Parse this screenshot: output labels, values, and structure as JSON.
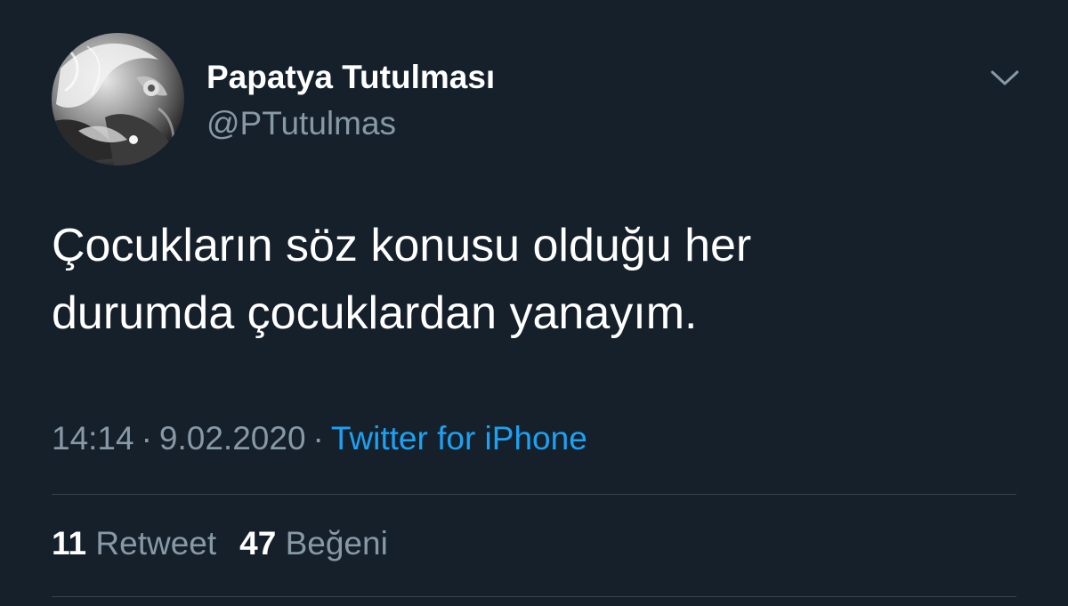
{
  "tweet": {
    "author": {
      "display_name": "Papatya Tutulması",
      "handle": "@PTutulmas"
    },
    "text_lines": [
      "Çocukların söz konusu olduğu her",
      "durumda çocuklardan yanayım."
    ],
    "time": "14:14",
    "separator": "·",
    "date": "9.02.2020",
    "source": "Twitter for iPhone",
    "stats": {
      "retweets_count": "11",
      "retweets_label": "Retweet",
      "likes_count": "47",
      "likes_label": "Beğeni"
    },
    "icons": {
      "menu": "chevron-down-icon"
    }
  },
  "theme": {
    "background": "#15202b",
    "primary_text": "#ffffff",
    "secondary_text": "#8899a6",
    "accent": "#1da1f2",
    "divider": "#38444d"
  }
}
